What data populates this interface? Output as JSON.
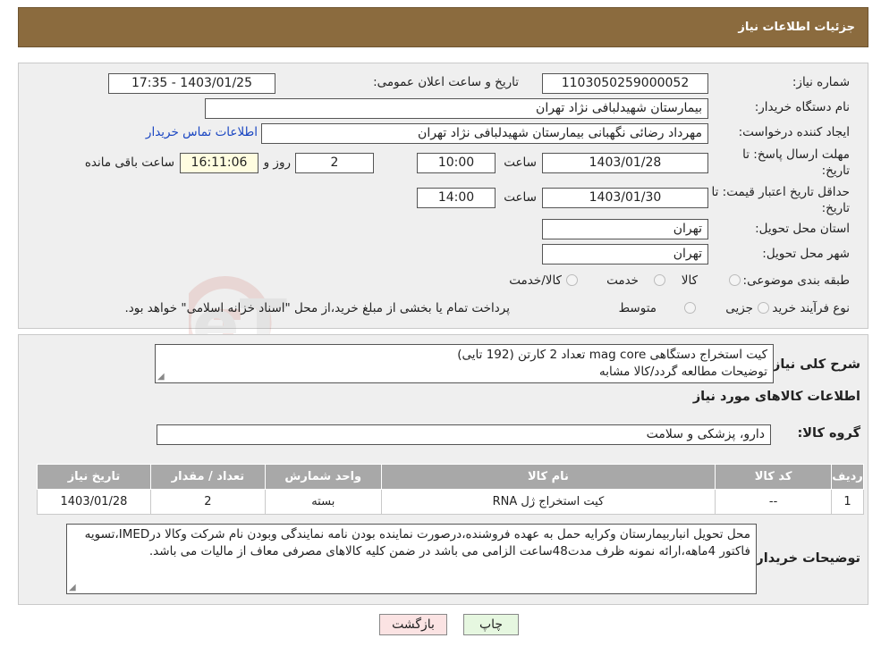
{
  "header": {
    "title": "جزئیات اطلاعات نیاز"
  },
  "watermark_text": "AriaTender.neT",
  "form": {
    "need_number_label": "شماره نیاز:",
    "need_number": "1103050259000052",
    "announce_label": "تاریخ و ساعت اعلان عمومی:",
    "announce_value": "1403/01/25 - 17:35",
    "buyer_org_label": "نام دستگاه خریدار:",
    "buyer_org": "بیمارستان شهیدلبافی نژاد تهران",
    "creator_label": "ایجاد کننده درخواست:",
    "creator": "مهرداد رضائی نگهبانی بیمارستان شهیدلبافی نژاد تهران",
    "contact_link": "اطلاعات تماس خریدار",
    "deadline_label_1": "مهلت ارسال پاسخ: تا",
    "deadline_label_2": "تاریخ:",
    "deadline_date": "1403/01/28",
    "time_label": "ساعت",
    "deadline_time": "10:00",
    "days_value": "2",
    "days_label": "روز و",
    "remaining_time": "16:11:06",
    "remaining_label": "ساعت باقی مانده",
    "validity_label_1": "حداقل تاریخ اعتبار قیمت: تا",
    "validity_label_2": "تاریخ:",
    "validity_date": "1403/01/30",
    "validity_time": "14:00",
    "province_label": "استان محل تحویل:",
    "province": "تهران",
    "city_label": "شهر محل تحویل:",
    "city": "تهران",
    "category_label": "طبقه بندی موضوعی:",
    "category_options": [
      "کالا",
      "خدمت",
      "کالا/خدمت"
    ],
    "process_label": "نوع فرآیند خرید :",
    "process_options": [
      "جزیی",
      "متوسط"
    ],
    "process_note": "پرداخت تمام یا بخشی از مبلغ خرید،از محل \"اسناد خزانه اسلامی\" خواهد بود."
  },
  "summary": {
    "label": "شرح کلی نیاز:",
    "line1": "کیت استخراج دستگاهی mag core تعداد 2 کارتن (192 تایی)",
    "line2": "توضیحات مطالعه گردد/کالا مشابه"
  },
  "goods_section_title": "اطلاعات کالاهای مورد نیاز",
  "goods_group": {
    "label": "گروه کالا:",
    "value": "دارو، پزشکی و سلامت"
  },
  "table": {
    "headers": [
      "ردیف",
      "کد کالا",
      "نام کالا",
      "واحد شمارش",
      "تعداد / مقدار",
      "تاریخ نیاز"
    ],
    "rows": [
      [
        "1",
        "--",
        "کیت استخراج ژل RNA",
        "بسته",
        "2",
        "1403/01/28"
      ]
    ]
  },
  "buyer_notes": {
    "label": "توضیحات خریدار:",
    "text": "محل تحویل انباربیمارستان وکرایه حمل به عهده فروشنده،درصورت نماینده بودن نامه نمایندگی وبودن نام شرکت وکالا درIMED،تسویه فاکتور 4ماهه،ارائه نمونه ظرف مدت48ساعت الزامی می باشد  در ضمن کلیه کالاهای مصرفی معاف از مالیات می باشد."
  },
  "buttons": {
    "back": "بازگشت",
    "print": "چاپ"
  },
  "colors": {
    "header": "#8b6b3e",
    "panel": "#efefef",
    "table_header": "#a8a8a8",
    "link": "#1a46c2"
  }
}
